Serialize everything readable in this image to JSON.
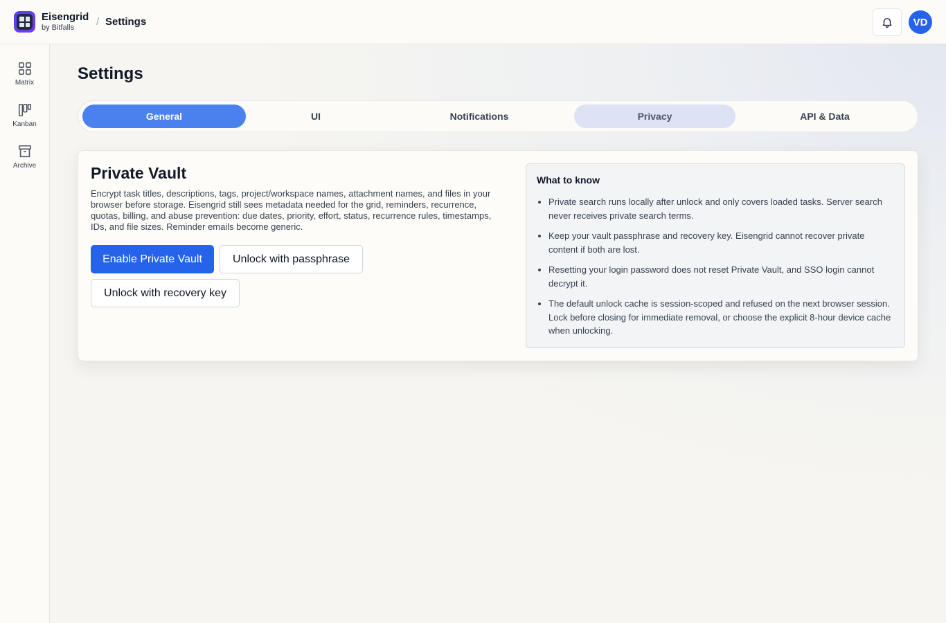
{
  "brand": {
    "name": "Eisengrid",
    "sub": "by Bitfalls"
  },
  "breadcrumb": {
    "separator": "/",
    "current": "Settings"
  },
  "user": {
    "initials": "VD"
  },
  "sidebar": {
    "items": [
      {
        "label": "Matrix",
        "icon": "grid-icon"
      },
      {
        "label": "Kanban",
        "icon": "kanban-icon"
      },
      {
        "label": "Archive",
        "icon": "archive-icon"
      }
    ]
  },
  "page": {
    "title": "Settings"
  },
  "tabs": [
    {
      "label": "General",
      "state": "active"
    },
    {
      "label": "UI",
      "state": "normal"
    },
    {
      "label": "Notifications",
      "state": "normal"
    },
    {
      "label": "Privacy",
      "state": "hover"
    },
    {
      "label": "API & Data",
      "state": "normal"
    }
  ],
  "vault": {
    "title": "Private Vault",
    "description": "Encrypt task titles, descriptions, tags, project/workspace names, attachment names, and files in your browser before storage. Eisengrid still sees metadata needed for the grid, reminders, recurrence, quotas, billing, and abuse prevention: due dates, priority, effort, status, recurrence rules, timestamps, IDs, and file sizes. Reminder emails become generic.",
    "enable_label": "Enable Private Vault",
    "unlock_passphrase_label": "Unlock with passphrase",
    "unlock_recovery_label": "Unlock with recovery key"
  },
  "info": {
    "title": "What to know",
    "items": [
      "Private search runs locally after unlock and only covers loaded tasks. Server search never receives private search terms.",
      "Keep your vault passphrase and recovery key. Eisengrid cannot recover private content if both are lost.",
      "Resetting your login password does not reset Private Vault, and SSO login cannot decrypt it.",
      "The default unlock cache is session-scoped and refused on the next browser session. Lock before closing for immediate removal, or choose the explicit 8-hour device cache when unlocking."
    ]
  },
  "colors": {
    "accent": "#2563eb",
    "tab_active": "#4a81ee",
    "tab_hover": "#dde3f5"
  }
}
